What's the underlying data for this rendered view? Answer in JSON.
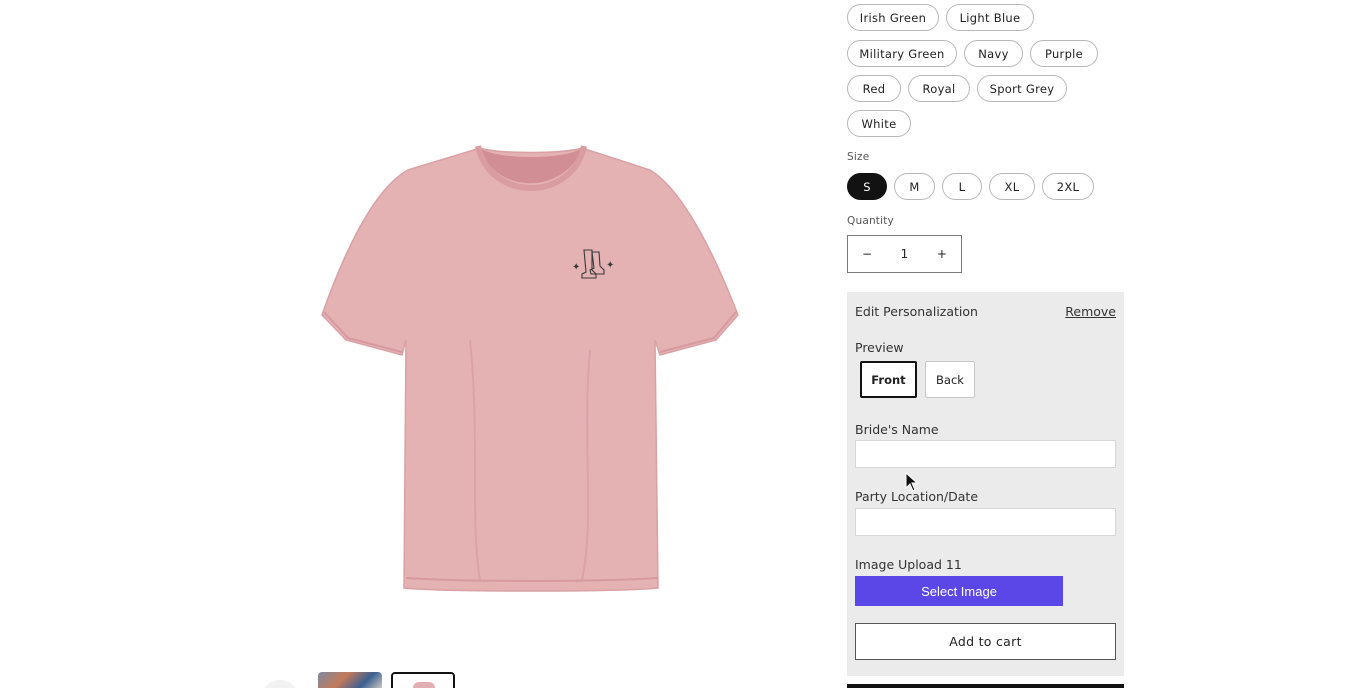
{
  "product": {
    "image_alt": "Pink t-shirt with cowboy boots design",
    "colors": [
      "Irish Green",
      "Light Blue",
      "Military Green",
      "Navy",
      "Purple",
      "Red",
      "Royal",
      "Sport Grey",
      "White"
    ],
    "size_label": "Size",
    "sizes": [
      "S",
      "M",
      "L",
      "XL",
      "2XL"
    ],
    "selected_size": "S",
    "quantity_label": "Quantity",
    "quantity_value": "1",
    "decrement": "−",
    "increment": "+"
  },
  "personalization": {
    "title": "Edit Personalization",
    "remove_label": "Remove",
    "preview_label": "Preview",
    "preview_front": "Front",
    "preview_back": "Back",
    "brides_name_label": "Bride's Name",
    "brides_name_value": "",
    "party_label": "Party Location/Date",
    "party_value": "",
    "image_upload_label": "Image Upload 11",
    "select_image_label": "Select Image"
  },
  "cart": {
    "add_to_cart_label": "Add to cart"
  },
  "colors": {
    "accent": "#5b46e8",
    "shirt": "#e5b2b4",
    "panel": "#ebebeb"
  }
}
